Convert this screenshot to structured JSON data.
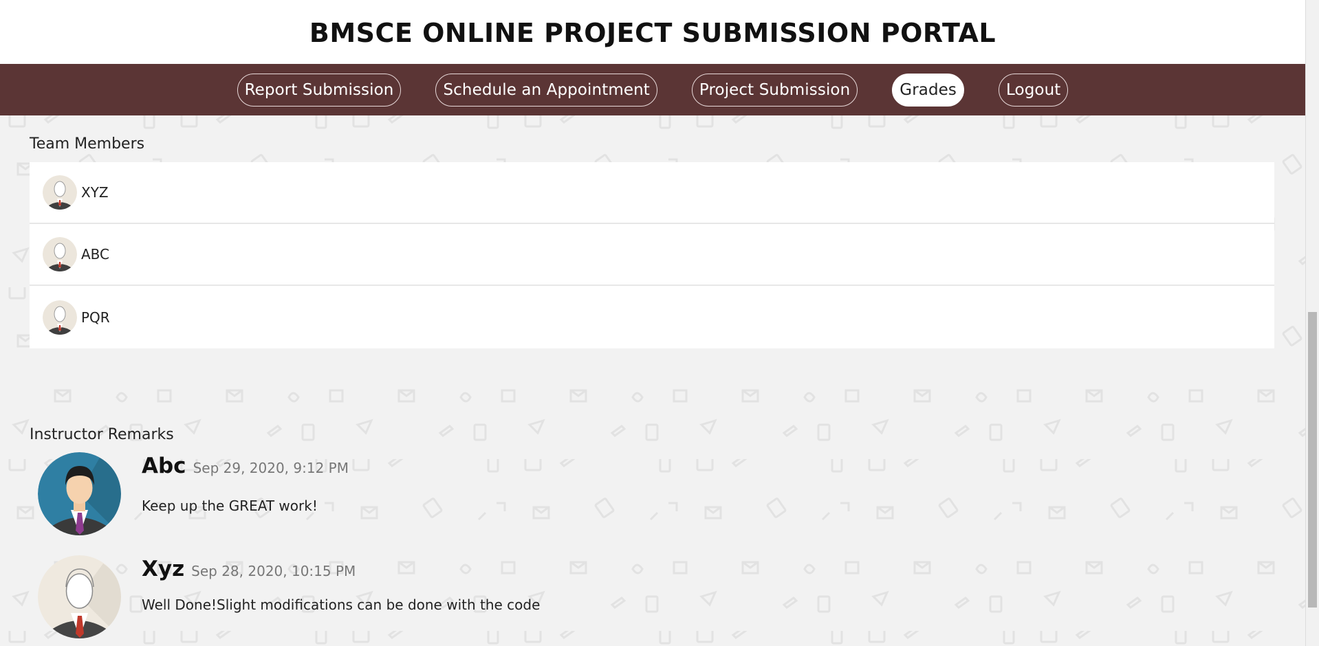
{
  "header": {
    "title": "BMSCE ONLINE PROJECT SUBMISSION PORTAL"
  },
  "nav": {
    "items": [
      {
        "label": "Report Submission",
        "active": false
      },
      {
        "label": "Schedule an Appointment",
        "active": false
      },
      {
        "label": "Project Submission",
        "active": false
      },
      {
        "label": "Grades",
        "active": true
      },
      {
        "label": "Logout",
        "active": false
      }
    ]
  },
  "team": {
    "heading": "Team Members",
    "members": [
      {
        "name": "XYZ",
        "avatar_icon": "user-avatar-icon"
      },
      {
        "name": "ABC",
        "avatar_icon": "user-avatar-icon"
      },
      {
        "name": "PQR",
        "avatar_icon": "user-avatar-icon"
      }
    ]
  },
  "remarks": {
    "heading": "Instructor Remarks",
    "items": [
      {
        "author": "Abc",
        "time": "Sep 29, 2020, 9:12 PM",
        "text": "Keep up the GREAT work!",
        "avatar_icon": "businessman-avatar-icon"
      },
      {
        "author": "Xyz",
        "time": "Sep 28, 2020, 10:15 PM",
        "text": "Well Done!Slight modifications can be done with the code",
        "avatar_icon": "user-avatar-icon"
      }
    ]
  },
  "colors": {
    "navbar": "#5b3535",
    "background": "#f2f2f2",
    "card": "#ffffff"
  }
}
